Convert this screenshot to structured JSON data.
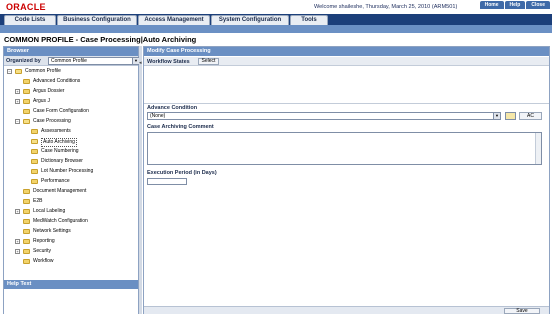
{
  "brand": {
    "logo": "ORACLE",
    "color": "#cc0000"
  },
  "welcome": "Welcome shaileshe, Thursday, March 25, 2010 (ARM501)",
  "toplinks": [
    "Home",
    "Help",
    "Close"
  ],
  "menu": [
    "Code Lists",
    "Business Configuration",
    "Access Management",
    "System Configuration",
    "Tools"
  ],
  "page_title": "COMMON PROFILE - Case Processing|Auto Archiving",
  "browser": {
    "header": "Browser",
    "organized_by_label": "Organized by",
    "organized_by_value": "Common Profile",
    "tree": [
      {
        "label": "Common Profile",
        "expander": "−",
        "open": true
      },
      {
        "label": "Advanced Conditions",
        "expander": ""
      },
      {
        "label": "Argus Dossier",
        "expander": "+"
      },
      {
        "label": "Argus J",
        "expander": "+"
      },
      {
        "label": "Case Form Configuration",
        "expander": ""
      },
      {
        "label": "Case Processing",
        "expander": "−",
        "open": true
      },
      {
        "label": "Assessments",
        "expander": ""
      },
      {
        "label": "Auto Archiving",
        "expander": "",
        "selected": true
      },
      {
        "label": "Case Numbering",
        "expander": ""
      },
      {
        "label": "Dictionary Browser",
        "expander": ""
      },
      {
        "label": "Lot Number Processing",
        "expander": ""
      },
      {
        "label": "Performance",
        "expander": ""
      },
      {
        "label": "Document Management",
        "expander": ""
      },
      {
        "label": "E2B",
        "expander": ""
      },
      {
        "label": "Local Labeling",
        "expander": "+"
      },
      {
        "label": "MedWatch Configuration",
        "expander": ""
      },
      {
        "label": "Network Settings",
        "expander": ""
      },
      {
        "label": "Reporting",
        "expander": "+"
      },
      {
        "label": "Security",
        "expander": "+"
      },
      {
        "label": "Workflow",
        "expander": ""
      }
    ]
  },
  "help": {
    "header": "Help Text"
  },
  "modify": {
    "header": "Modify Case Processing",
    "workflow_states_label": "Workflow States",
    "select_button": "Select",
    "advance_condition_label": "Advance Condition",
    "advance_condition_value": "(None)",
    "ac_button": "AC",
    "archiving_comment_label": "Case Archiving Comment",
    "execution_period_label": "Execution Period (in Days)",
    "save_button": "Save"
  },
  "colors": {
    "menubar": "#1c3f7a",
    "pane_header": "#6a8fc3",
    "accent": "#3f6aa8"
  }
}
